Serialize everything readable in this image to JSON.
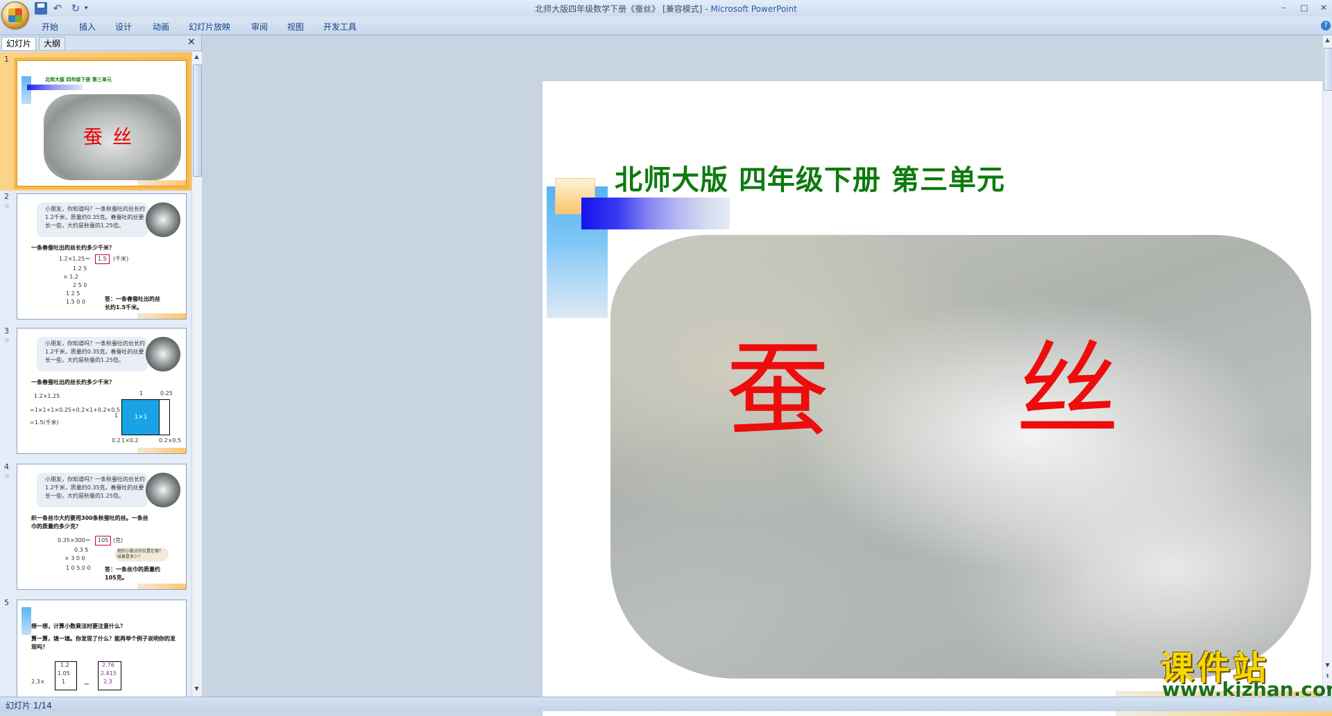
{
  "window": {
    "title": "北师大版四年级数学下册《蚕丝》 [兼容模式] - ",
    "app_name": "Microsoft PowerPoint",
    "minimize": "–",
    "maximize": "□",
    "close": "✕"
  },
  "quick_access": {
    "undo": "↶",
    "redo": "↻",
    "more": "▾"
  },
  "ribbon": {
    "tabs": [
      "开始",
      "插入",
      "设计",
      "动画",
      "幻灯片放映",
      "审阅",
      "视图",
      "开发工具"
    ],
    "help": "?"
  },
  "left_panel": {
    "tabs": [
      "幻灯片",
      "大纲"
    ],
    "close": "✕"
  },
  "thumbnails": [
    {
      "number": "1",
      "header": "北师大版  四年级下册  第三单元",
      "title": "蚕丝"
    },
    {
      "number": "2",
      "star": "☆",
      "intro": "小朋友，你知道吗？一条秋蚕吐的丝长约1.2千米，质量约0.35克。春蚕吐的丝要长一些，大约是秋蚕的1.25倍。",
      "question": "一条春蚕吐出的丝长约多少千米？",
      "equation": "1.2×1.25＝",
      "answer_box": "1.5",
      "unit": "(千米)",
      "calc": [
        "1.2 5",
        "×   1.2",
        "2 5 0",
        "1 2 5",
        "1.5 0 0"
      ],
      "answer": "答：一条春蚕吐出的丝长约1.5千米。"
    },
    {
      "number": "3",
      "star": "☆",
      "intro": "小朋友，你知道吗？一条秋蚕吐的丝长约1.2千米，质量约0.35克。春蚕吐的丝要长一些，大约是秋蚕的1.25倍。",
      "question": "一条春蚕吐出的丝长约多少千米？",
      "equation": "1.2×1.25",
      "step1": "=1×1+1×0.25+0.2×1+0.2×0.5",
      "step2": "=1.5(千米)",
      "grid_labels": [
        "1",
        "0.25",
        "1",
        "0.2",
        "1×1",
        "1×0.25",
        "1×0.2",
        "0.2×0.5"
      ]
    },
    {
      "number": "4",
      "star": "☆",
      "intro": "小朋友，你知道吗？一条秋蚕吐的丝长约1.2千米，质量约0.35克。春蚕吐的丝要长一些，大约是秋蚕的1.25倍。",
      "question": "织一条丝巾大约要用300条秋蚕吐的丝。一条丝巾的质量约多少克？",
      "equation": "0.35×300＝",
      "answer_box": "105",
      "unit": "(克)",
      "calc": [
        "0.3 5",
        "×   3 0 0",
        "1 0 5.0 0"
      ],
      "bubble": "积的小数点的位置在哪？结果是多少？",
      "answer": "答：一条丝巾的质量约105克。"
    },
    {
      "number": "5",
      "q1": "想一想，计算小数乘法时要注意什么？",
      "q2": "算一算，填一填。你发现了什么？能再举个例子说明你的发现吗？",
      "left_col": [
        "1.2",
        "1.05",
        "1"
      ],
      "right_col": [
        "2.76",
        "2.415",
        "2.3"
      ],
      "multiplier": "2.3×",
      "eq": "＝"
    }
  ],
  "slide": {
    "header": "北师大版  四年级下册  第三单元",
    "title": "蚕 丝"
  },
  "watermark": {
    "name": "课件站",
    "url": "www.kjzhan.com"
  },
  "status": {
    "text": "幻灯片 1/14"
  }
}
